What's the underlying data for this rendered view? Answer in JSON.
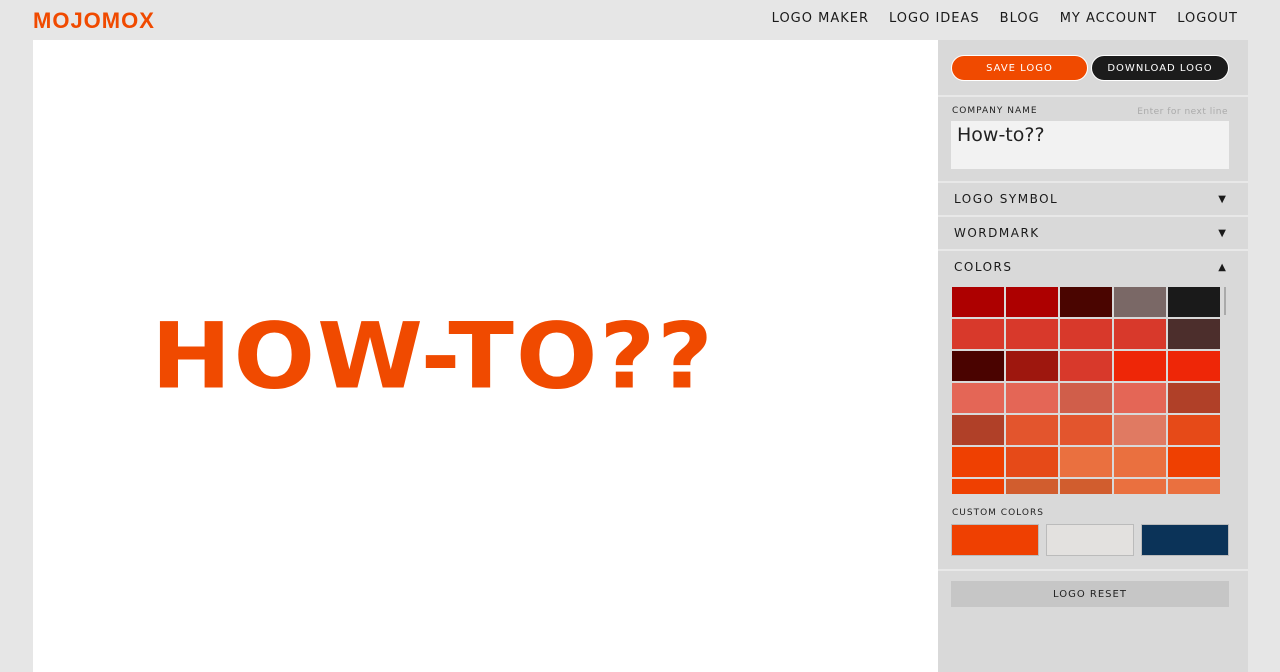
{
  "brand": "MOJOMOX",
  "nav": [
    "LOGO MAKER",
    "LOGO IDEAS",
    "BLOG",
    "MY ACCOUNT",
    "LOGOUT"
  ],
  "canvas": {
    "logo_text": "HOW-TO??",
    "logo_color": "#f04a00"
  },
  "panel": {
    "save_label": "SAVE LOGO",
    "download_label": "DOWNLOAD LOGO",
    "company_name_label": "COMPANY NAME",
    "company_name_hint": "Enter for next line",
    "company_name_value": "How-to??",
    "sections": [
      {
        "label": "LOGO SYMBOL",
        "icon": "triangle-down"
      },
      {
        "label": "WORDMARK",
        "icon": "triangle-down"
      },
      {
        "label": "COLORS",
        "icon": "triangle-up"
      }
    ],
    "palette": [
      "#ad0000",
      "#ad0000",
      "#4a0500",
      "#7a6866",
      "#1a1a1a",
      "#d8392b",
      "#d8392b",
      "#d8392b",
      "#d8392b",
      "#4c2e2c",
      "#4a0300",
      "#9e170e",
      "#d8392b",
      "#ee2607",
      "#ee2607",
      "#e46656",
      "#e46656",
      "#d05e4a",
      "#e46656",
      "#b04028",
      "#b04028",
      "#e3552d",
      "#e3552d",
      "#e07a62",
      "#e64a18",
      "#ef4001",
      "#e64a18",
      "#ea703f",
      "#ea703f",
      "#ef4001",
      "#ef4001",
      "#d15d2e",
      "#d15d2e",
      "#ea703f",
      "#ea703f"
    ],
    "custom_colors_label": "CUSTOM COLORS",
    "custom_colors": [
      "#ef4001",
      "#e3e1df",
      "#0b3358"
    ],
    "reset_label": "LOGO RESET"
  }
}
